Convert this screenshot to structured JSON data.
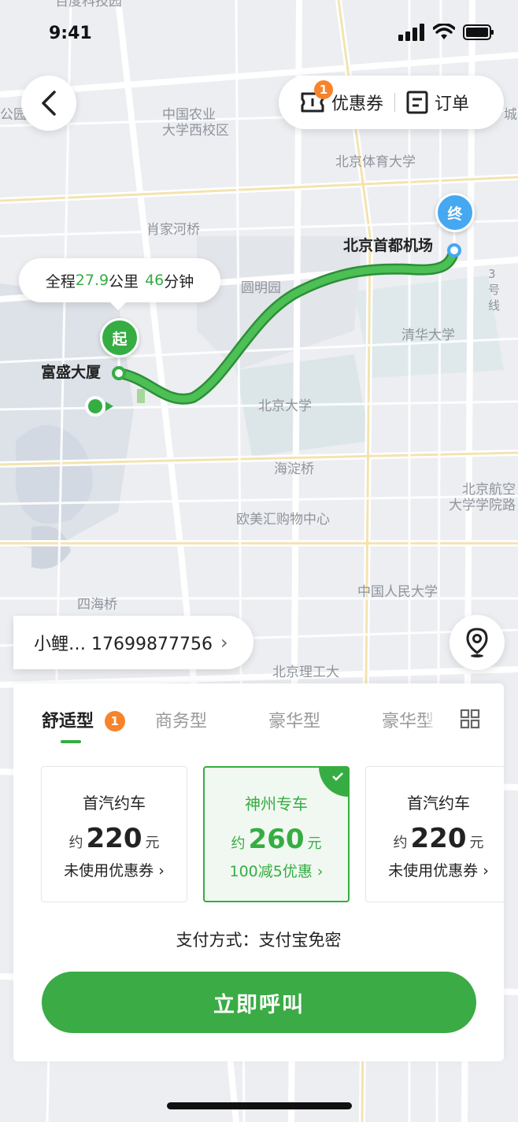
{
  "status_bar": {
    "time": "9:41"
  },
  "top_bar": {
    "coupon_label": "优惠券",
    "coupon_badge": "1",
    "order_label": "订单"
  },
  "map": {
    "labels": [
      "中国农业\n大学西校区",
      "北京体育大学",
      "肖家河桥",
      "圆明园",
      "清华大学",
      "北京大学",
      "海淀桥",
      "欧美汇购物中心",
      "北京航空\n大学学院路",
      "中国人民大学",
      "四海桥",
      "北京理工大",
      "百度科技园",
      "3号线",
      "公园",
      "城"
    ],
    "route_colors": {
      "route": "#35ad42",
      "end_pin": "#45a8f0"
    }
  },
  "trip": {
    "prefix": "全程",
    "distance": "27.9",
    "distance_unit": "公里",
    "duration": "46",
    "duration_unit": "分钟"
  },
  "start": {
    "pin_label": "起",
    "name": "富盛大厦"
  },
  "end": {
    "pin_label": "终",
    "name": "北京首都机场"
  },
  "contact": {
    "text": "小鲤… 17699877756",
    "chevron": "›"
  },
  "tabs": [
    {
      "label": "舒适型",
      "badge": "1"
    },
    {
      "label": "商务型"
    },
    {
      "label": "豪华型"
    },
    {
      "label": "豪华型"
    }
  ],
  "cards": [
    {
      "name": "首汽约车",
      "prefix": "约",
      "price": "220",
      "unit": "元",
      "coupon": "未使用优惠券 ›"
    },
    {
      "name": "神州专车",
      "prefix": "约",
      "price": "260",
      "unit": "元",
      "coupon": "100减5优惠 ›",
      "selected": true
    },
    {
      "name": "首汽约车",
      "prefix": "约",
      "price": "220",
      "unit": "元",
      "coupon": "未使用优惠券 ›"
    }
  ],
  "payment": {
    "text": "支付方式：支付宝免密"
  },
  "call_button": {
    "label": "立即呼叫"
  },
  "colors": {
    "accent": "#35ad42",
    "badge": "#f7832b"
  }
}
